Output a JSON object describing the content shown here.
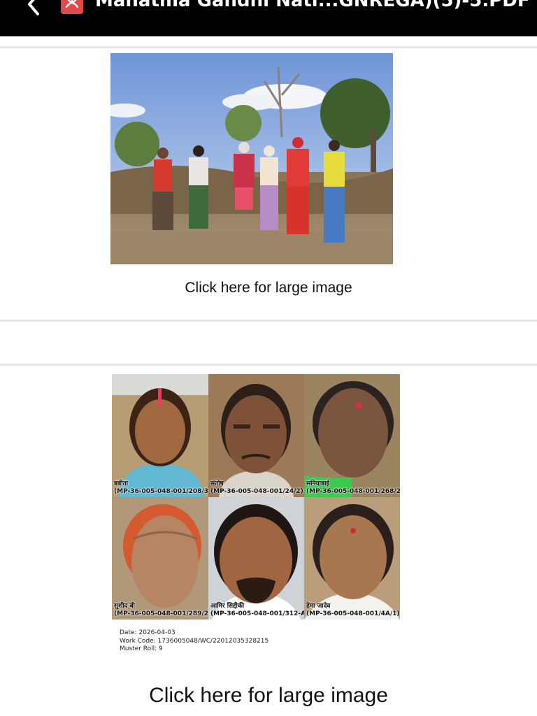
{
  "app_bar": {
    "title": "Mahatma Gandhi Nati...GNREGA)(5)-5.PDF",
    "back_icon": "chevron-left-icon",
    "file_icon": "pdf-icon"
  },
  "section_group": {
    "caption": "Click here for large image"
  },
  "section_faces": {
    "workers": [
      {
        "name": "बबीता",
        "id": "(MP-36-005-048-001/208/3)"
      },
      {
        "name": "संतोष",
        "id": "(MP-36-005-048-001/24/2)"
      },
      {
        "name": "सनियाबाई",
        "id": "(MP-36-005-048-001/268/2)"
      },
      {
        "name": "सुशीद बी",
        "id": "(MP-36-005-048-001/289/2)"
      },
      {
        "name": "आमिर सिद्दीकी",
        "id": "(MP-36-005-048-001/312-A)"
      },
      {
        "name": "हेमा जादेव",
        "id": "(MP-36-005-048-001/4A/1)"
      }
    ],
    "date": "Date: 2026-04-03",
    "work_code": "Work Code: 1736005048/WC/22012035328215",
    "muster_roll": "Muster Roll: 9",
    "caption": "Click here for large image"
  }
}
